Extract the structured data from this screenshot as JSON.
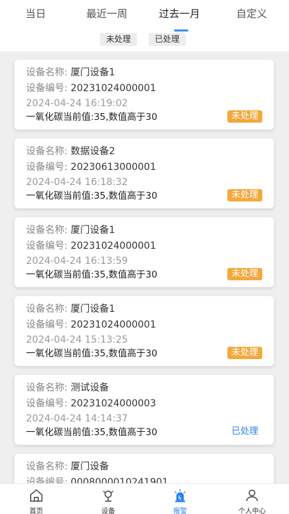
{
  "tabs": [
    {
      "label": "当日"
    },
    {
      "label": "最近一周"
    },
    {
      "label": "过去一月",
      "active": true
    },
    {
      "label": "自定义"
    }
  ],
  "filters": [
    "未处理",
    "已处理"
  ],
  "field_labels": {
    "device_name": "设备名称:",
    "device_id": "设备编号:"
  },
  "alarms": [
    {
      "device_name": "厦门设备1",
      "device_id": "20231024000001",
      "time": "2024-04-24 16:19:02",
      "message": "一氧化碳当前值:35,数值高于30",
      "status": "未处理"
    },
    {
      "device_name": "数据设备2",
      "device_id": "20230613000001",
      "time": "2024-04-24 16:18:32",
      "message": "一氧化碳当前值:35,数值高于30",
      "status": "未处理"
    },
    {
      "device_name": "厦门设备1",
      "device_id": "20231024000001",
      "time": "2024-04-24 16:13:59",
      "message": "一氧化碳当前值:35,数值高于30",
      "status": "未处理"
    },
    {
      "device_name": "厦门设备1",
      "device_id": "20231024000001",
      "time": "2024-04-24 15:13:25",
      "message": "一氧化碳当前值:35,数值高于30",
      "status": "未处理"
    },
    {
      "device_name": "测试设备",
      "device_id": "20231024000003",
      "time": "2024-04-24 14:14:37",
      "message": "一氧化碳当前值:35,数值高于30",
      "status": "已处理"
    },
    {
      "device_name": "厦门设备",
      "device_id": "0008000010241901",
      "time": "",
      "message": "",
      "status": ""
    }
  ],
  "bottom_nav": [
    {
      "label": "首页",
      "icon": "home-icon"
    },
    {
      "label": "设备",
      "icon": "device-icon"
    },
    {
      "label": "报警",
      "icon": "alarm-icon",
      "active": true
    },
    {
      "label": "个人中心",
      "icon": "user-icon"
    }
  ],
  "colors": {
    "accent": "#3b8ef0",
    "unhandled_badge": "#f3a93c",
    "handled_text": "#2a7ff0"
  }
}
